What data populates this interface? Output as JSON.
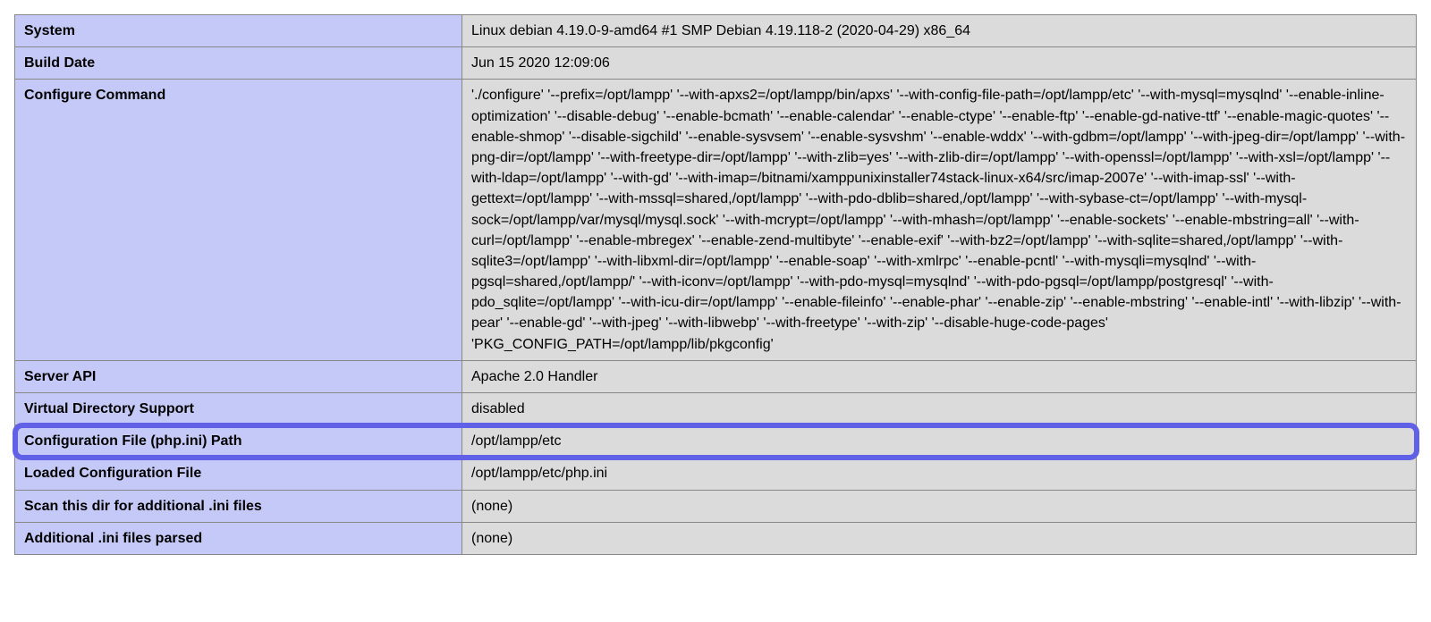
{
  "rows": [
    {
      "key": "System",
      "value": "Linux debian 4.19.0-9-amd64 #1 SMP Debian 4.19.118-2 (2020-04-29) x86_64",
      "highlighted": false
    },
    {
      "key": "Build Date",
      "value": "Jun 15 2020 12:09:06",
      "highlighted": false
    },
    {
      "key": "Configure Command",
      "value": "'./configure' '--prefix=/opt/lampp' '--with-apxs2=/opt/lampp/bin/apxs' '--with-config-file-path=/opt/lampp/etc' '--with-mysql=mysqlnd' '--enable-inline-optimization' '--disable-debug' '--enable-bcmath' '--enable-calendar' '--enable-ctype' '--enable-ftp' '--enable-gd-native-ttf' '--enable-magic-quotes' '--enable-shmop' '--disable-sigchild' '--enable-sysvsem' '--enable-sysvshm' '--enable-wddx' '--with-gdbm=/opt/lampp' '--with-jpeg-dir=/opt/lampp' '--with-png-dir=/opt/lampp' '--with-freetype-dir=/opt/lampp' '--with-zlib=yes' '--with-zlib-dir=/opt/lampp' '--with-openssl=/opt/lampp' '--with-xsl=/opt/lampp' '--with-ldap=/opt/lampp' '--with-gd' '--with-imap=/bitnami/xamppunixinstaller74stack-linux-x64/src/imap-2007e' '--with-imap-ssl' '--with-gettext=/opt/lampp' '--with-mssql=shared,/opt/lampp' '--with-pdo-dblib=shared,/opt/lampp' '--with-sybase-ct=/opt/lampp' '--with-mysql-sock=/opt/lampp/var/mysql/mysql.sock' '--with-mcrypt=/opt/lampp' '--with-mhash=/opt/lampp' '--enable-sockets' '--enable-mbstring=all' '--with-curl=/opt/lampp' '--enable-mbregex' '--enable-zend-multibyte' '--enable-exif' '--with-bz2=/opt/lampp' '--with-sqlite=shared,/opt/lampp' '--with-sqlite3=/opt/lampp' '--with-libxml-dir=/opt/lampp' '--enable-soap' '--with-xmlrpc' '--enable-pcntl' '--with-mysqli=mysqlnd' '--with-pgsql=shared,/opt/lampp/' '--with-iconv=/opt/lampp' '--with-pdo-mysql=mysqlnd' '--with-pdo-pgsql=/opt/lampp/postgresql' '--with-pdo_sqlite=/opt/lampp' '--with-icu-dir=/opt/lampp' '--enable-fileinfo' '--enable-phar' '--enable-zip' '--enable-mbstring' '--enable-intl' '--with-libzip' '--with-pear' '--enable-gd' '--with-jpeg' '--with-libwebp' '--with-freetype' '--with-zip' '--disable-huge-code-pages' 'PKG_CONFIG_PATH=/opt/lampp/lib/pkgconfig'",
      "highlighted": false
    },
    {
      "key": "Server API",
      "value": "Apache 2.0 Handler",
      "highlighted": false
    },
    {
      "key": "Virtual Directory Support",
      "value": "disabled",
      "highlighted": false
    },
    {
      "key": "Configuration File (php.ini) Path",
      "value": "/opt/lampp/etc",
      "highlighted": true
    },
    {
      "key": "Loaded Configuration File",
      "value": "/opt/lampp/etc/php.ini",
      "highlighted": false
    },
    {
      "key": "Scan this dir for additional .ini files",
      "value": "(none)",
      "highlighted": false
    },
    {
      "key": "Additional .ini files parsed",
      "value": "(none)",
      "highlighted": false
    }
  ]
}
